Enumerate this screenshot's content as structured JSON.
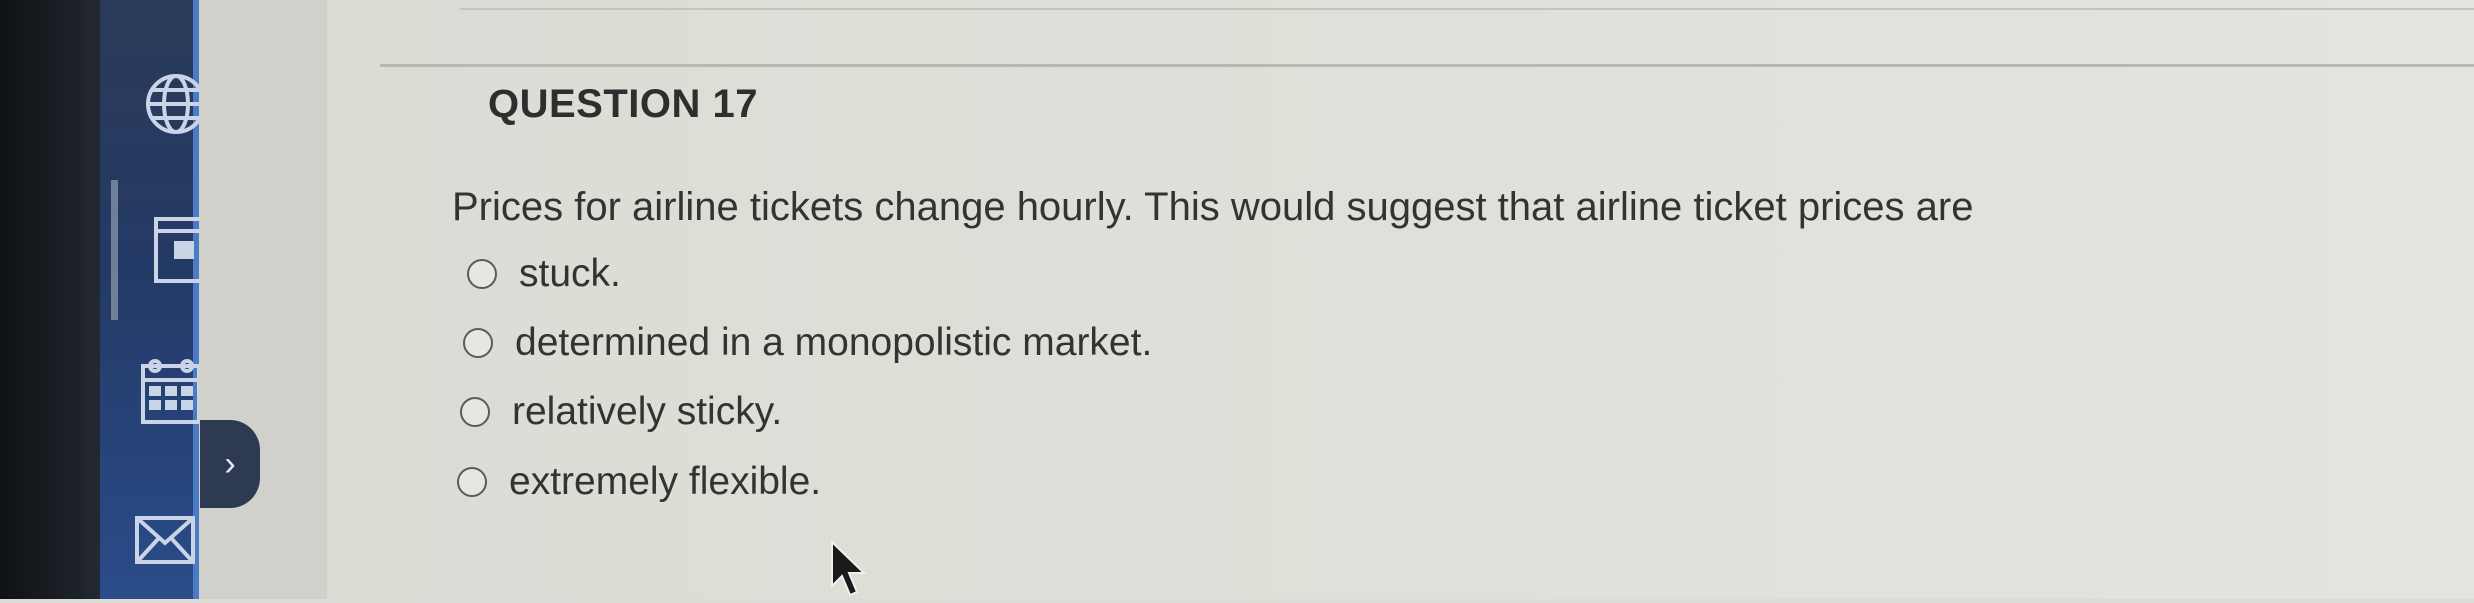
{
  "question": {
    "title": "QUESTION 17",
    "prompt": "Prices for airline tickets change hourly. This would suggest that airline ticket prices are",
    "options": [
      {
        "label": "stuck.",
        "selected": false
      },
      {
        "label": "determined in a monopolistic market.",
        "selected": false
      },
      {
        "label": "relatively sticky.",
        "selected": false
      },
      {
        "label": "extremely flexible.",
        "selected": false
      }
    ]
  },
  "nav": {
    "icons": [
      "globe-icon",
      "book-icon",
      "calendar-icon",
      "mail-icon"
    ],
    "collapse_glyph": "›"
  },
  "colors": {
    "nav_rail": "#243a66",
    "nav_edge": "#4a7bc4",
    "content_bg": "#dfe0d9",
    "text": "#333333"
  }
}
